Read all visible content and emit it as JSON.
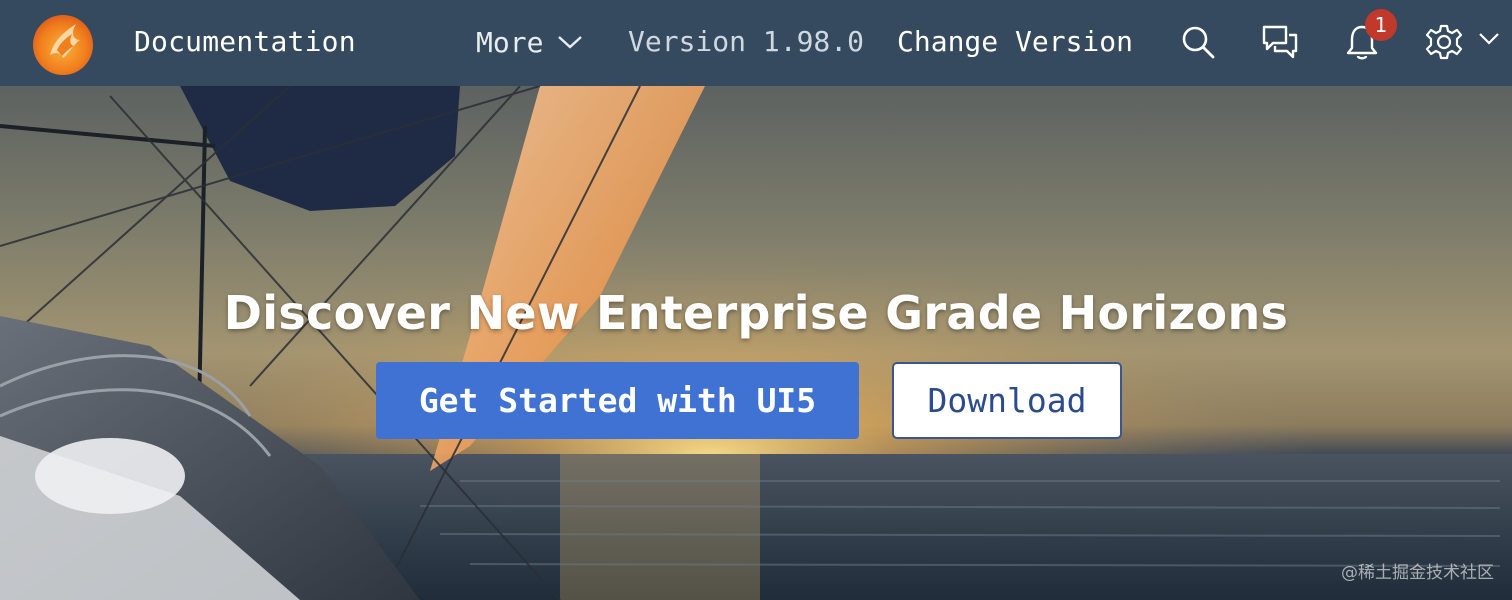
{
  "header": {
    "brand": "Documentation",
    "more_label": "More",
    "version_label": "Version 1.98.0",
    "change_version_label": "Change Version",
    "icons": [
      "search-icon",
      "feedback-icon",
      "notifications-icon",
      "settings-icon"
    ],
    "notifications_count": "1"
  },
  "hero": {
    "title": "Discover New Enterprise Grade Horizons",
    "primary_button": "Get Started with UI5",
    "secondary_button": "Download",
    "watermark": "@稀土掘金技术社区"
  },
  "colors": {
    "shellbar": "#354a5f",
    "primary": "#3f72d3",
    "badge": "#c0392b",
    "secondary_border": "#3a5690"
  }
}
